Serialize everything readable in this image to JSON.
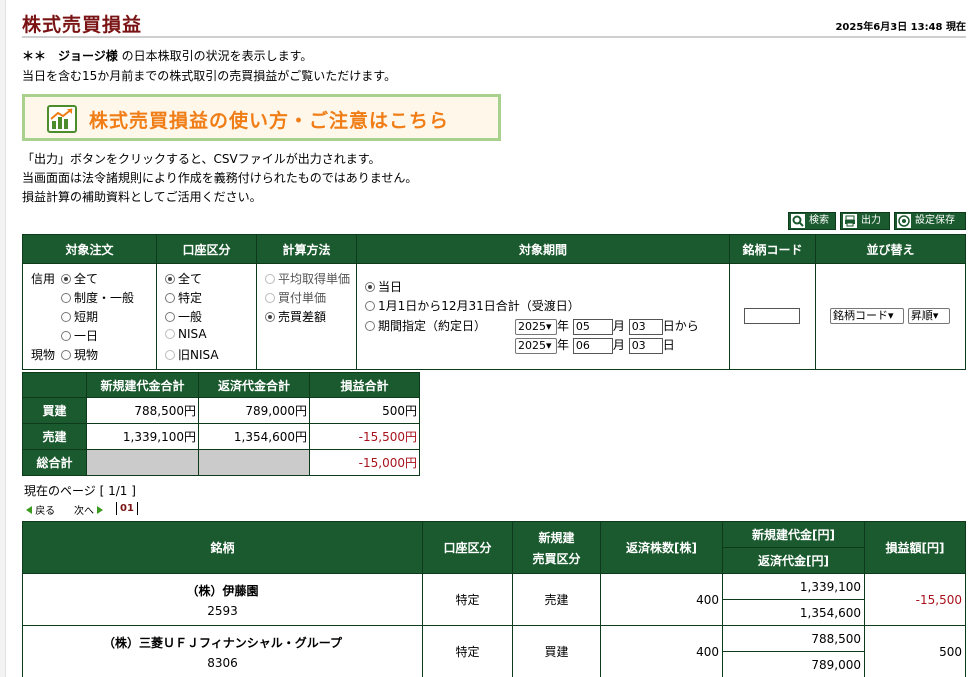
{
  "page": {
    "title": "株式売買損益",
    "timestamp": "2025年6月3日 13:48 現在",
    "intro_prefix": "＊＊　ジョージ様",
    "intro_line1": " の日本株取引の状況を表示します。",
    "intro_line2": "当日を含む15か月前までの株式取引の売買損益がご覧いただけます。",
    "banner": "株式売買損益の使い方・ご注意はこちら",
    "notes": [
      "「出力」ボタンをクリックすると、CSVファイルが出力されます。",
      "当画面面は法令諸規則により作成を義務付けられたものではありません。",
      "損益計算の補助資料としてご活用ください。"
    ]
  },
  "toolbar": {
    "search": "検索",
    "output": "出力",
    "save": "設定保存"
  },
  "conditions": {
    "headers": [
      "対象注文",
      "口座区分",
      "計算方法",
      "対象期間",
      "銘柄コード",
      "並び替え"
    ],
    "order": {
      "credit_label": "信用",
      "spot_label": "現物",
      "options": [
        "全て",
        "制度・一般",
        "短期",
        "一日",
        "現物"
      ]
    },
    "account": {
      "options": [
        "全て",
        "特定",
        "一般",
        "NISA",
        "旧NISA"
      ]
    },
    "method": {
      "options": [
        "平均取得単価",
        "買付単価",
        "売買差額"
      ]
    },
    "period": {
      "options": [
        "当日",
        "1月1日から12月31日合計（受渡日）",
        "期間指定（約定日）"
      ],
      "from": {
        "year": "2025",
        "month": "05",
        "day": "03",
        "suffix": "日から"
      },
      "to": {
        "year": "2025",
        "month": "06",
        "day": "03",
        "suffix": "日"
      },
      "year_unit": "年",
      "month_unit": "月"
    },
    "code_value": "",
    "sort": {
      "key": "銘柄コード",
      "order": "昇順"
    }
  },
  "summary": {
    "headers": [
      "新規建代金合計",
      "返済代金合計",
      "損益合計"
    ],
    "rows": [
      {
        "label": "買建",
        "new": "788,500円",
        "repay": "789,000円",
        "pl": "500円"
      },
      {
        "label": "売建",
        "new": "1,339,100円",
        "repay": "1,354,600円",
        "pl": "-15,500円"
      }
    ],
    "total_label": "総合計",
    "total_pl": "-15,000円"
  },
  "pager": {
    "label": "現在のページ [ 1/1 ]",
    "prev": "戻る",
    "next": "次へ",
    "page": "01"
  },
  "results": {
    "headers": {
      "name": "銘柄",
      "account": "口座区分",
      "side_l1": "新規建",
      "side_l2": "売買区分",
      "qty": "返済株数[株]",
      "amount_l1": "新規建代金[円]",
      "amount_l2": "返済代金[円]",
      "pl": "損益額[円]"
    },
    "rows": [
      {
        "name": "（株）伊藤園",
        "code": "2593",
        "account": "特定",
        "side": "売建",
        "qty": "400",
        "new": "1,339,100",
        "repay": "1,354,600",
        "pl": "-15,500"
      },
      {
        "name": "（株）三菱ＵＦＪフィナンシャル・グループ",
        "code": "8306",
        "account": "特定",
        "side": "買建",
        "qty": "400",
        "new": "788,500",
        "repay": "789,000",
        "pl": "500"
      }
    ]
  },
  "colors": {
    "header_green": "#1a5a2e",
    "title_red": "#7a1414",
    "banner_orange": "#f07d16",
    "negative": "#a8131d"
  }
}
